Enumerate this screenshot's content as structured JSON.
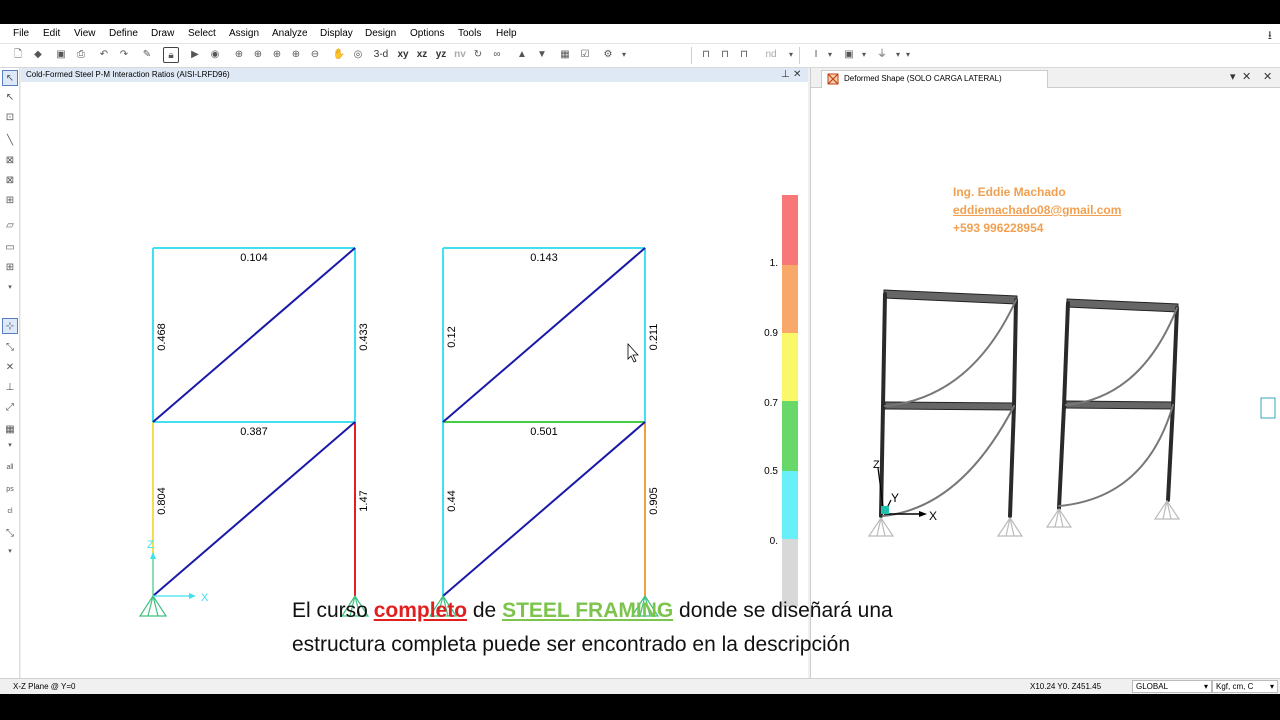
{
  "menu": [
    "File",
    "Edit",
    "View",
    "Define",
    "Draw",
    "Select",
    "Assign",
    "Analyze",
    "Display",
    "Design",
    "Options",
    "Tools",
    "Help"
  ],
  "toolbar": {
    "view_3d": "3-d",
    "view_xy": "xy",
    "view_xz": "xz",
    "view_yz": "yz",
    "view_nv": "nv",
    "nd": "nd"
  },
  "left_pane": {
    "title": "Cold-Formed Steel P-M Interaction Ratios  (AISI-LRFD96)",
    "pin_icon": "pin-icon",
    "close_icon": "close-icon",
    "frames": [
      {
        "beam_top": "0.104",
        "beam_mid": "0.387",
        "col_left_upper": "0.468",
        "col_right_upper": "0.433",
        "col_left_lower": "0.804",
        "col_right_lower": "1.47"
      },
      {
        "beam_top": "0.143",
        "beam_mid": "0.501",
        "col_left_upper": "0.12",
        "col_right_upper": "0.211",
        "col_left_lower": "0.44",
        "col_right_lower": "0.905"
      }
    ],
    "axis_z": "Z",
    "axis_x": "X",
    "legend": {
      "ticks": [
        "1.",
        "0.9",
        "0.7",
        "0.5",
        "0."
      ],
      "colors": [
        "#f87878",
        "#f8a868",
        "#f8f868",
        "#68d868",
        "#68f0f8",
        "#d8d8d8"
      ]
    },
    "member_colors": {
      "cyan": "#40e0f0",
      "blue": "#1a1aa8",
      "yellow": "#f0e050",
      "red": "#e02020",
      "green": "#40d040",
      "orange": "#f0a040",
      "support": "#40c080"
    }
  },
  "right_pane": {
    "tab_title": "Deformed Shape (SOLO CARGA LATERAL)",
    "contact_name": "Ing. Eddie Machado",
    "contact_email": "eddiemachado08@gmail.com",
    "contact_phone": "+593 996228954",
    "axis_x": "X",
    "axis_y": "Y",
    "axis_z": "Z"
  },
  "caption": {
    "part1": "El curso ",
    "highlight1": "completo",
    "part2": " de ",
    "highlight2": "STEEL FRAMING",
    "part3": " donde se diseñará una",
    "line2": "estructura completa puede ser encontrado en la descripción"
  },
  "status": {
    "plane": "X-Z Plane @ Y=0",
    "coords": "X10.24  Y0.  Z451.45",
    "coord_system": "GLOBAL",
    "units": "Kgf, cm, C"
  }
}
